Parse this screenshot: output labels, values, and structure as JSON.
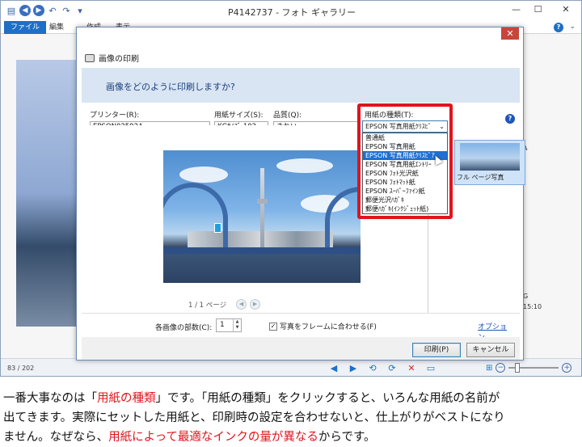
{
  "window": {
    "title": "P4142737 - フォト ギャラリー",
    "ribbon_tabs": [
      "ファイル",
      "編集",
      "作成",
      "表示"
    ]
  },
  "status": {
    "counter": "83 / 202",
    "info_a": "A",
    "info_g": "G",
    "info_time": "15:10"
  },
  "dialog": {
    "title": "画像の印刷",
    "question": "画像をどのように印刷しますか?",
    "printer": {
      "label": "プリンター(R):",
      "value": "EPSON02592A"
    },
    "paper_size": {
      "label": "用紙サイズ(S):",
      "value": "KGｻｲｽﾞ 102"
    },
    "quality": {
      "label": "品質(Q):",
      "value": "きれい"
    },
    "paper_type": {
      "label": "用紙の種類(T):",
      "value": "EPSON 写真用紙ｸﾘｽﾋﾟ",
      "options": [
        "普通紙",
        "EPSON 写真用紙",
        "EPSON 写真用紙ｸﾘｽﾋﾟｱ",
        "EPSON 写真用紙ｴﾝﾄﾘｰ",
        "EPSON ﾌｫﾄ光沢紙",
        "EPSON ﾌｫﾄﾏｯﾄ紙",
        "EPSON ｽｰﾊﾟｰﾌｧｲﾝ紙",
        "郵便光沢ﾊｶﾞｷ",
        "郵便ﾊｶﾞｷ(ｲﾝｸｼﾞｪｯﾄ紙)"
      ],
      "selected_index": 2
    },
    "page_indicator": "1 / 1 ページ",
    "layout_label": "フル ページ写真",
    "copies_label": "各画像の部数(C):",
    "copies_value": "1",
    "fit_label": "写真をフレームに合わせる(F)",
    "fit_checked": "✓",
    "options_link": "オプション...",
    "print_button": "印刷(P)",
    "cancel_button": "キャンセル"
  },
  "caption": {
    "line1_pre": "一番大事なのは「",
    "line1_hl": "用紙の種類",
    "line1_post": "」です。「用紙の種類」をクリックすると、いろんな用紙の名前が",
    "line2": "出てきます。実際にセットした用紙と、印刷時の設定を合わせないと、仕上がりがベストになり",
    "line3_pre": "ません。なぜなら、",
    "line3_hl": "用紙によって最適なインクの量が異なる",
    "line3_post": "からです。"
  },
  "icons": {
    "back": "back-icon",
    "forward": "forward-icon",
    "undo": "undo-icon",
    "close": "close-icon",
    "help": "help-icon",
    "printer": "printer-icon"
  }
}
